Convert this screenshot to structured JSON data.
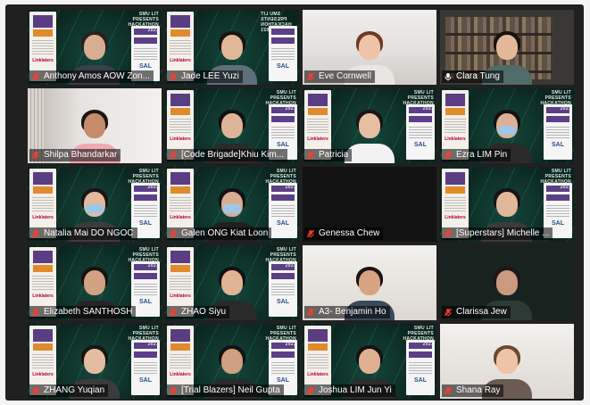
{
  "screen": {
    "title": ""
  },
  "tiles": [
    {
      "name": "Anthony Amos AOW Zon...",
      "muted": true,
      "bg": "hack",
      "hair": "#2a211d",
      "skin": "#d7ae92",
      "shirt": "#3a3f45"
    },
    {
      "name": "Jade LEE Yuzi",
      "muted": true,
      "bg": "hack-mirror",
      "active": true,
      "hair": "#19120f",
      "skin": "#e0b798",
      "shirt": "#5f6f7a"
    },
    {
      "name": "Eve Cornwell",
      "muted": true,
      "bg": "room-white",
      "hair": "#6b3a23",
      "skin": "#eec3a8",
      "shirt": "#e9e6e2"
    },
    {
      "name": "Clara Tung",
      "muted": false,
      "bg": "room-shelf",
      "hair": "#171310",
      "skin": "#e3b898",
      "shirt": "#4f6b6a"
    },
    {
      "name": "Shilpa Bhandarkar",
      "muted": true,
      "bg": "room-window",
      "hair": "#1d1513",
      "skin": "#c68b6a",
      "shirt": "#f0a8b1"
    },
    {
      "name": "[Code Brigade]Khiu Kim...",
      "muted": true,
      "bg": "hack",
      "hair": "#141010",
      "skin": "#ddb497",
      "shirt": "#2b2b2b"
    },
    {
      "name": "Patricia",
      "muted": true,
      "bg": "hack",
      "hair": "#1b1411",
      "skin": "#e6bea2",
      "shirt": "#f2f2f2"
    },
    {
      "name": "Ezra LIM Pin",
      "muted": true,
      "bg": "hack",
      "hair": "#151110",
      "skin": "#dcb096",
      "shirt": "#2a2a2a",
      "mask": true
    },
    {
      "name": "Natalia Mai DO NGOC",
      "muted": true,
      "bg": "hack",
      "hair": "#1a1412",
      "skin": "#e3b99c",
      "shirt": "#3c3c3c",
      "mask": true
    },
    {
      "name": "Galen ONG Kiat Loon",
      "muted": true,
      "bg": "hack",
      "hair": "#121010",
      "skin": "#d9ad93",
      "shirt": "#202020",
      "mask": true
    },
    {
      "name": "Genessa Chew",
      "muted": true,
      "bg": "room-dark",
      "empty": true
    },
    {
      "name": "[Superstars] Michelle ...",
      "muted": true,
      "bg": "hack",
      "hair": "#191312",
      "skin": "#e2b89a",
      "shirt": "#3b3b3b"
    },
    {
      "name": "Elizabeth SANTHOSH",
      "muted": true,
      "bg": "hack",
      "hair": "#171210",
      "skin": "#d1a184",
      "shirt": "#252525"
    },
    {
      "name": "ZHAO Siyu",
      "muted": true,
      "bg": "hack",
      "hair": "#141111",
      "skin": "#e0b596",
      "shirt": "#2a2a2a"
    },
    {
      "name": "A3- Benjamin Ho",
      "muted": true,
      "bg": "room-bright",
      "hair": "#1a1412",
      "skin": "#d6a383",
      "shirt": "#3a4a5b"
    },
    {
      "name": "Clarissa Jew",
      "muted": true,
      "bg": "room-greenish",
      "hair": "#201614",
      "skin": "#c99a7f",
      "shirt": "#2d3b36"
    },
    {
      "name": "ZHANG Yuqian",
      "muted": true,
      "bg": "hack",
      "hair": "#191413",
      "skin": "#e3bda1",
      "shirt": "#3b3b3b"
    },
    {
      "name": "[Trial Blazers] Neil Gupta",
      "muted": true,
      "bg": "hack",
      "hair": "#151111",
      "skin": "#cf9f82",
      "shirt": "#2a2a2a"
    },
    {
      "name": "Joshua LIM Jun Yi",
      "muted": true,
      "bg": "hack",
      "hair": "#171210",
      "skin": "#ddb092",
      "shirt": "#2d2d2d"
    },
    {
      "name": "Shana Ray",
      "muted": true,
      "bg": "room-bright",
      "hair": "#6a4a2d",
      "skin": "#eec3a8",
      "shirt": "#6a5c52"
    }
  ],
  "banner": {
    "line1": "SMU LIT",
    "line2": "PRESENTS",
    "line3": "HACKATHON 2021"
  },
  "poster": {
    "brand": "Linklaters"
  },
  "sidebar": {
    "brand": "SAL"
  },
  "colors": {
    "active_outline": "#d9e44a",
    "mute_icon": "#ff3b30"
  }
}
